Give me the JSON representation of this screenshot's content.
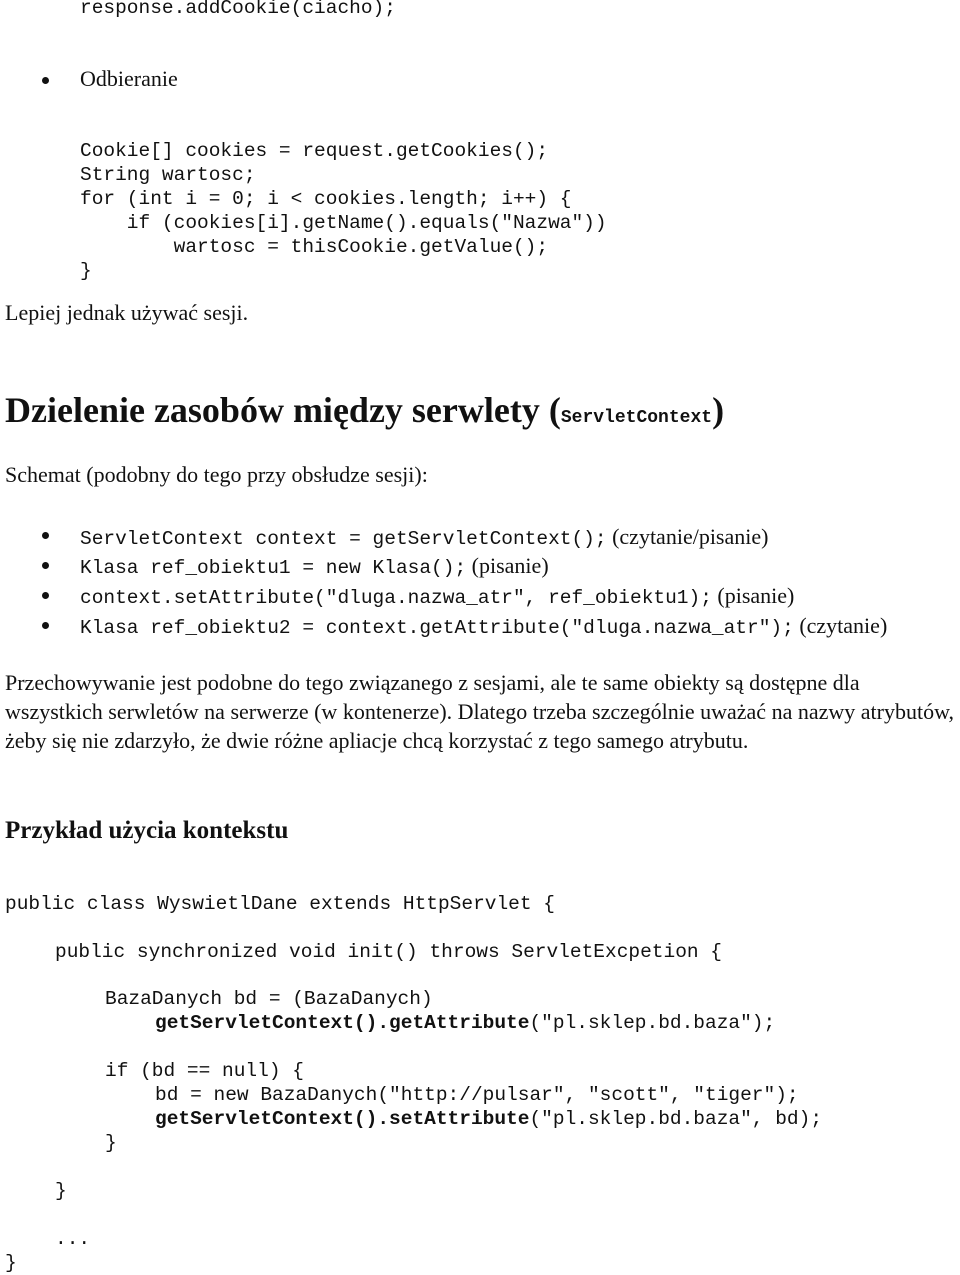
{
  "top_code": "response.addCookie(ciacho);",
  "receiving": {
    "bullet_label": "Odbieranie",
    "code_lines": [
      "Cookie[] cookies = request.getCookies();",
      "String wartosc;",
      "for (int i = 0; i < cookies.length; i++) {",
      "    if (cookies[i].getName().equals(\"Nazwa\"))",
      "        wartosc = thisCookie.getValue();",
      "}"
    ],
    "note": "Lepiej jednak używać sesji."
  },
  "section1": {
    "title": "Dzielenie zasobów między serwlety (",
    "title_code": "ServletContext",
    "title_close": ")",
    "intro": "Schemat (podobny do tego przy obsłudze sesji):",
    "items": [
      {
        "code": "ServletContext context = getServletContext();",
        "note": " (czytanie/pisanie)"
      },
      {
        "code": "Klasa ref_obiektu1 = new Klasa();",
        "note": " (pisanie)"
      },
      {
        "code": "context.setAttribute(\"dluga.nazwa_atr\", ref_obiektu1);",
        "note": " (pisanie)"
      },
      {
        "code": "Klasa ref_obiektu2 = context.getAttribute(\"dluga.nazwa_atr\");",
        "note": " (czytanie)"
      }
    ],
    "paragraph": "Przechowywanie jest podobne do tego związanego z sesjami, ale te same obiekty są dostępne dla wszystkich serwletów na serwerze (w kontenerze). Dlatego trzeba szczególnie uważać na nazwy atrybutów, żeby się nie zdarzyło, że dwie różne apliacje chcą korzystać z tego samego atrybutu."
  },
  "section2": {
    "title": "Przykład użycia kontekstu",
    "code": {
      "class_decl": "public class WyswietlDane extends HttpServlet {",
      "method_decl": "public synchronized void init() throws ServletExcpetion {",
      "line_bd_decl": "BazaDanych bd = (BazaDanych)",
      "line_get_bold": "getServletContext().getAttribute",
      "line_get_rest": "(\"pl.sklep.bd.baza\");",
      "line_if": "if (bd == null) {",
      "line_new": "bd = new BazaDanych(\"http://pulsar\", \"scott\", \"tiger\");",
      "line_set_bold": "getServletContext().setAttribute",
      "line_set_rest": "(\"pl.sklep.bd.baza\", bd);",
      "close_if": "}",
      "close_method": "}",
      "ellipsis": "...",
      "close_class": "}"
    }
  }
}
